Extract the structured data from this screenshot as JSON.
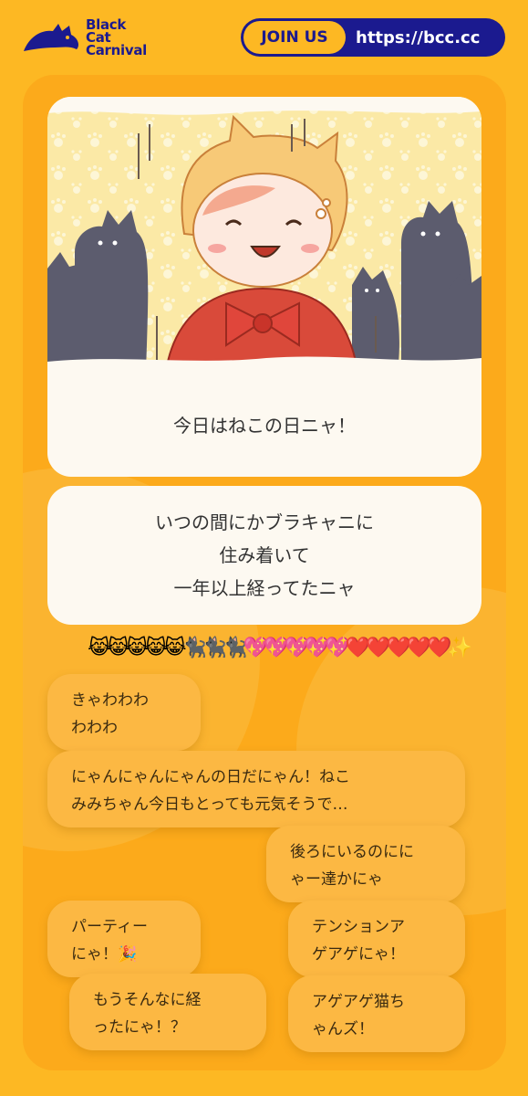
{
  "header": {
    "brand_line1": "Black",
    "brand_line2": "Cat",
    "brand_line3": "Carnival",
    "join_label": "JOIN US",
    "url": "https://bcc.cc"
  },
  "colors": {
    "brand_navy": "#1b1a8f",
    "background": "#fdb823",
    "card": "#fdf9f1",
    "bubble": "#fcb843"
  },
  "post": {
    "image_icon": "cat-costume-illustration",
    "caption": "今日はねこの日ニャ！",
    "message_lines": [
      "いつの間にかブラキャニに",
      "住み着いて",
      "一年以上経ってたニャ"
    ]
  },
  "reactions": {
    "emojis": "😹😹😹😹😹🐈‍⬛🐈‍⬛🐈‍⬛💖💖💖💖💖❤️❤️❤️❤️❤️✨"
  },
  "comments": [
    {
      "line1": "きゃわわわ",
      "line2": "わわわ"
    },
    {
      "line1": "にゃんにゃんにゃんの日だにゃん！ねこ",
      "line2": "みみちゃん今日もとっても元気そうで…"
    },
    {
      "line1": "後ろにいるのにに",
      "line2": "ゃー達かにゃ"
    },
    {
      "line1": "パーティー",
      "line2": "にゃ！🎉"
    },
    {
      "line1": "テンションア",
      "line2": "ゲアゲにゃ！"
    },
    {
      "line1": "もうそんなに経",
      "line2": "ったにゃ！？"
    },
    {
      "line1": "アゲアゲ猫ち",
      "line2": "ゃんズ！"
    }
  ]
}
